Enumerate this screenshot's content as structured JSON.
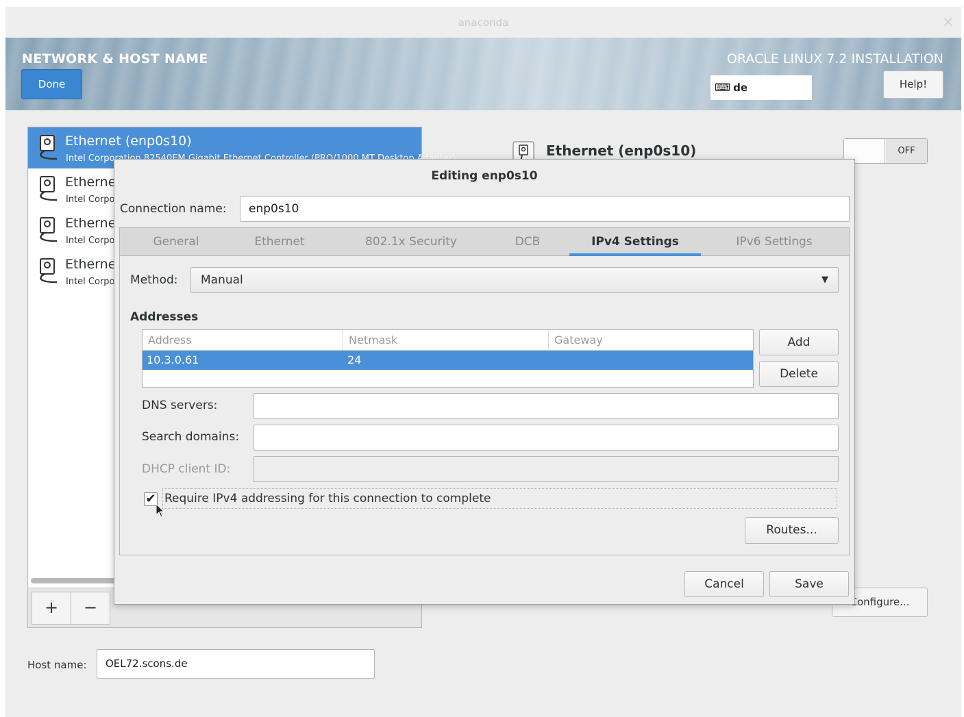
{
  "window": {
    "title": "anaconda",
    "close_glyph": "×"
  },
  "header": {
    "page_title": "NETWORK & HOST NAME",
    "done_label": "Done",
    "product_title": "ORACLE LINUX 7.2 INSTALLATION",
    "keyboard_layout": "de",
    "help_label": "Help!"
  },
  "network_list": {
    "items": [
      {
        "name": "Ethernet (enp0s10)",
        "description": "Intel Corporation 82540EM Gigabit Ethernet Controller (PRO/1000 MT Desktop Adapter)",
        "selected": true
      },
      {
        "name": "Etherne",
        "description": "Intel Corpo",
        "selected": false
      },
      {
        "name": "Etherne",
        "description": "Intel Corpo",
        "selected": false
      },
      {
        "name": "Etherne",
        "description": "Intel Corpo",
        "selected": false
      }
    ],
    "add_label": "+",
    "remove_label": "−"
  },
  "device_panel": {
    "name": "Ethernet (enp0s10)",
    "switch_state": "OFF",
    "configure_label": "Configure..."
  },
  "hostname": {
    "label": "Host name:",
    "value": "OEL72.scons.de"
  },
  "dialog": {
    "title": "Editing enp0s10",
    "connection_name_label": "Connection name:",
    "connection_name_value": "enp0s10",
    "tabs": [
      "General",
      "Ethernet",
      "802.1x Security",
      "DCB",
      "IPv4 Settings",
      "IPv6 Settings"
    ],
    "active_tab": "IPv4 Settings",
    "method_label": "Method:",
    "method_value": "Manual",
    "addresses_heading": "Addresses",
    "address_columns": [
      "Address",
      "Netmask",
      "Gateway"
    ],
    "address_rows": [
      {
        "address": "10.3.0.61",
        "netmask": "24",
        "gateway": ""
      }
    ],
    "add_label": "Add",
    "delete_label": "Delete",
    "dns_label": "DNS servers:",
    "dns_value": "",
    "search_label": "Search domains:",
    "search_value": "",
    "dhcp_label": "DHCP client ID:",
    "dhcp_value": "",
    "require_ipv4_label": "Require IPv4 addressing for this connection to complete",
    "require_ipv4_checked": true,
    "routes_label": "Routes...",
    "cancel_label": "Cancel",
    "save_label": "Save"
  },
  "colors": {
    "accent": "#4a90d9",
    "done_button": "#3a86d1"
  }
}
